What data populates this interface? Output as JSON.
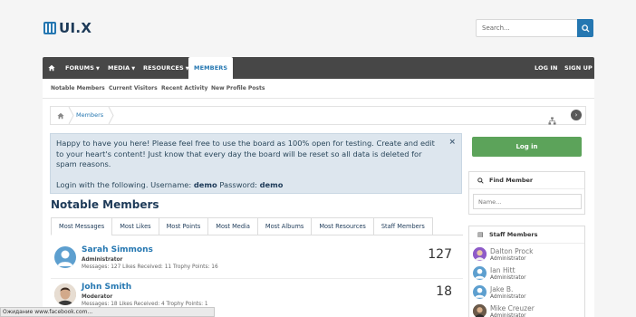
{
  "header": {
    "logo_text": "UI.X",
    "search_placeholder": "Search..."
  },
  "nav": {
    "forums": "FORUMS",
    "media": "MEDIA",
    "resources": "RESOURCES",
    "members": "MEMBERS",
    "login": "LOG IN",
    "signup": "SIGN UP"
  },
  "subnav": [
    "Notable Members",
    "Current Visitors",
    "Recent Activity",
    "New Profile Posts"
  ],
  "breadcrumb": {
    "current": "Members"
  },
  "notice": {
    "line1": "Happy to have you here! Please feel free to use the board as 100% open for testing. Create and edit to your heart's content! Just know that every day the board will be reset so all data is deleted for spam reasons.",
    "line2_prefix": "Login with the following. Username: ",
    "username": "demo",
    "password_label": " Password: ",
    "password": "demo",
    "close": "×"
  },
  "page_title": "Notable Members",
  "tabs": [
    "Most Messages",
    "Most Likes",
    "Most Points",
    "Most Media",
    "Most Albums",
    "Most Resources",
    "Staff Members"
  ],
  "members": [
    {
      "name": "Sarah Simmons",
      "role": "Administrator",
      "stats": "Messages: 127 Likes Received: 11 Trophy Points: 16",
      "count": "127"
    },
    {
      "name": "John Smith",
      "role": "Moderator",
      "stats": "Messages: 18 Likes Received: 4 Trophy Points: 1",
      "count": "18"
    }
  ],
  "sidebar": {
    "login_button": "Log in",
    "find_member_title": "Find Member",
    "name_placeholder": "Name...",
    "staff_title": "Staff Members",
    "staff": [
      {
        "name": "Dalton Prock",
        "role": "Administrator"
      },
      {
        "name": "Ian Hitt",
        "role": "Administrator"
      },
      {
        "name": "Jake B.",
        "role": "Administrator"
      },
      {
        "name": "Mike Creuzer",
        "role": "Administrator"
      }
    ]
  },
  "status_bar": "Ожидание www.facebook.com...",
  "colors": {
    "accent": "#2577b1",
    "nav_bg": "#474747",
    "login_green": "#5ca35a",
    "notice_bg": "#dde6ee"
  }
}
